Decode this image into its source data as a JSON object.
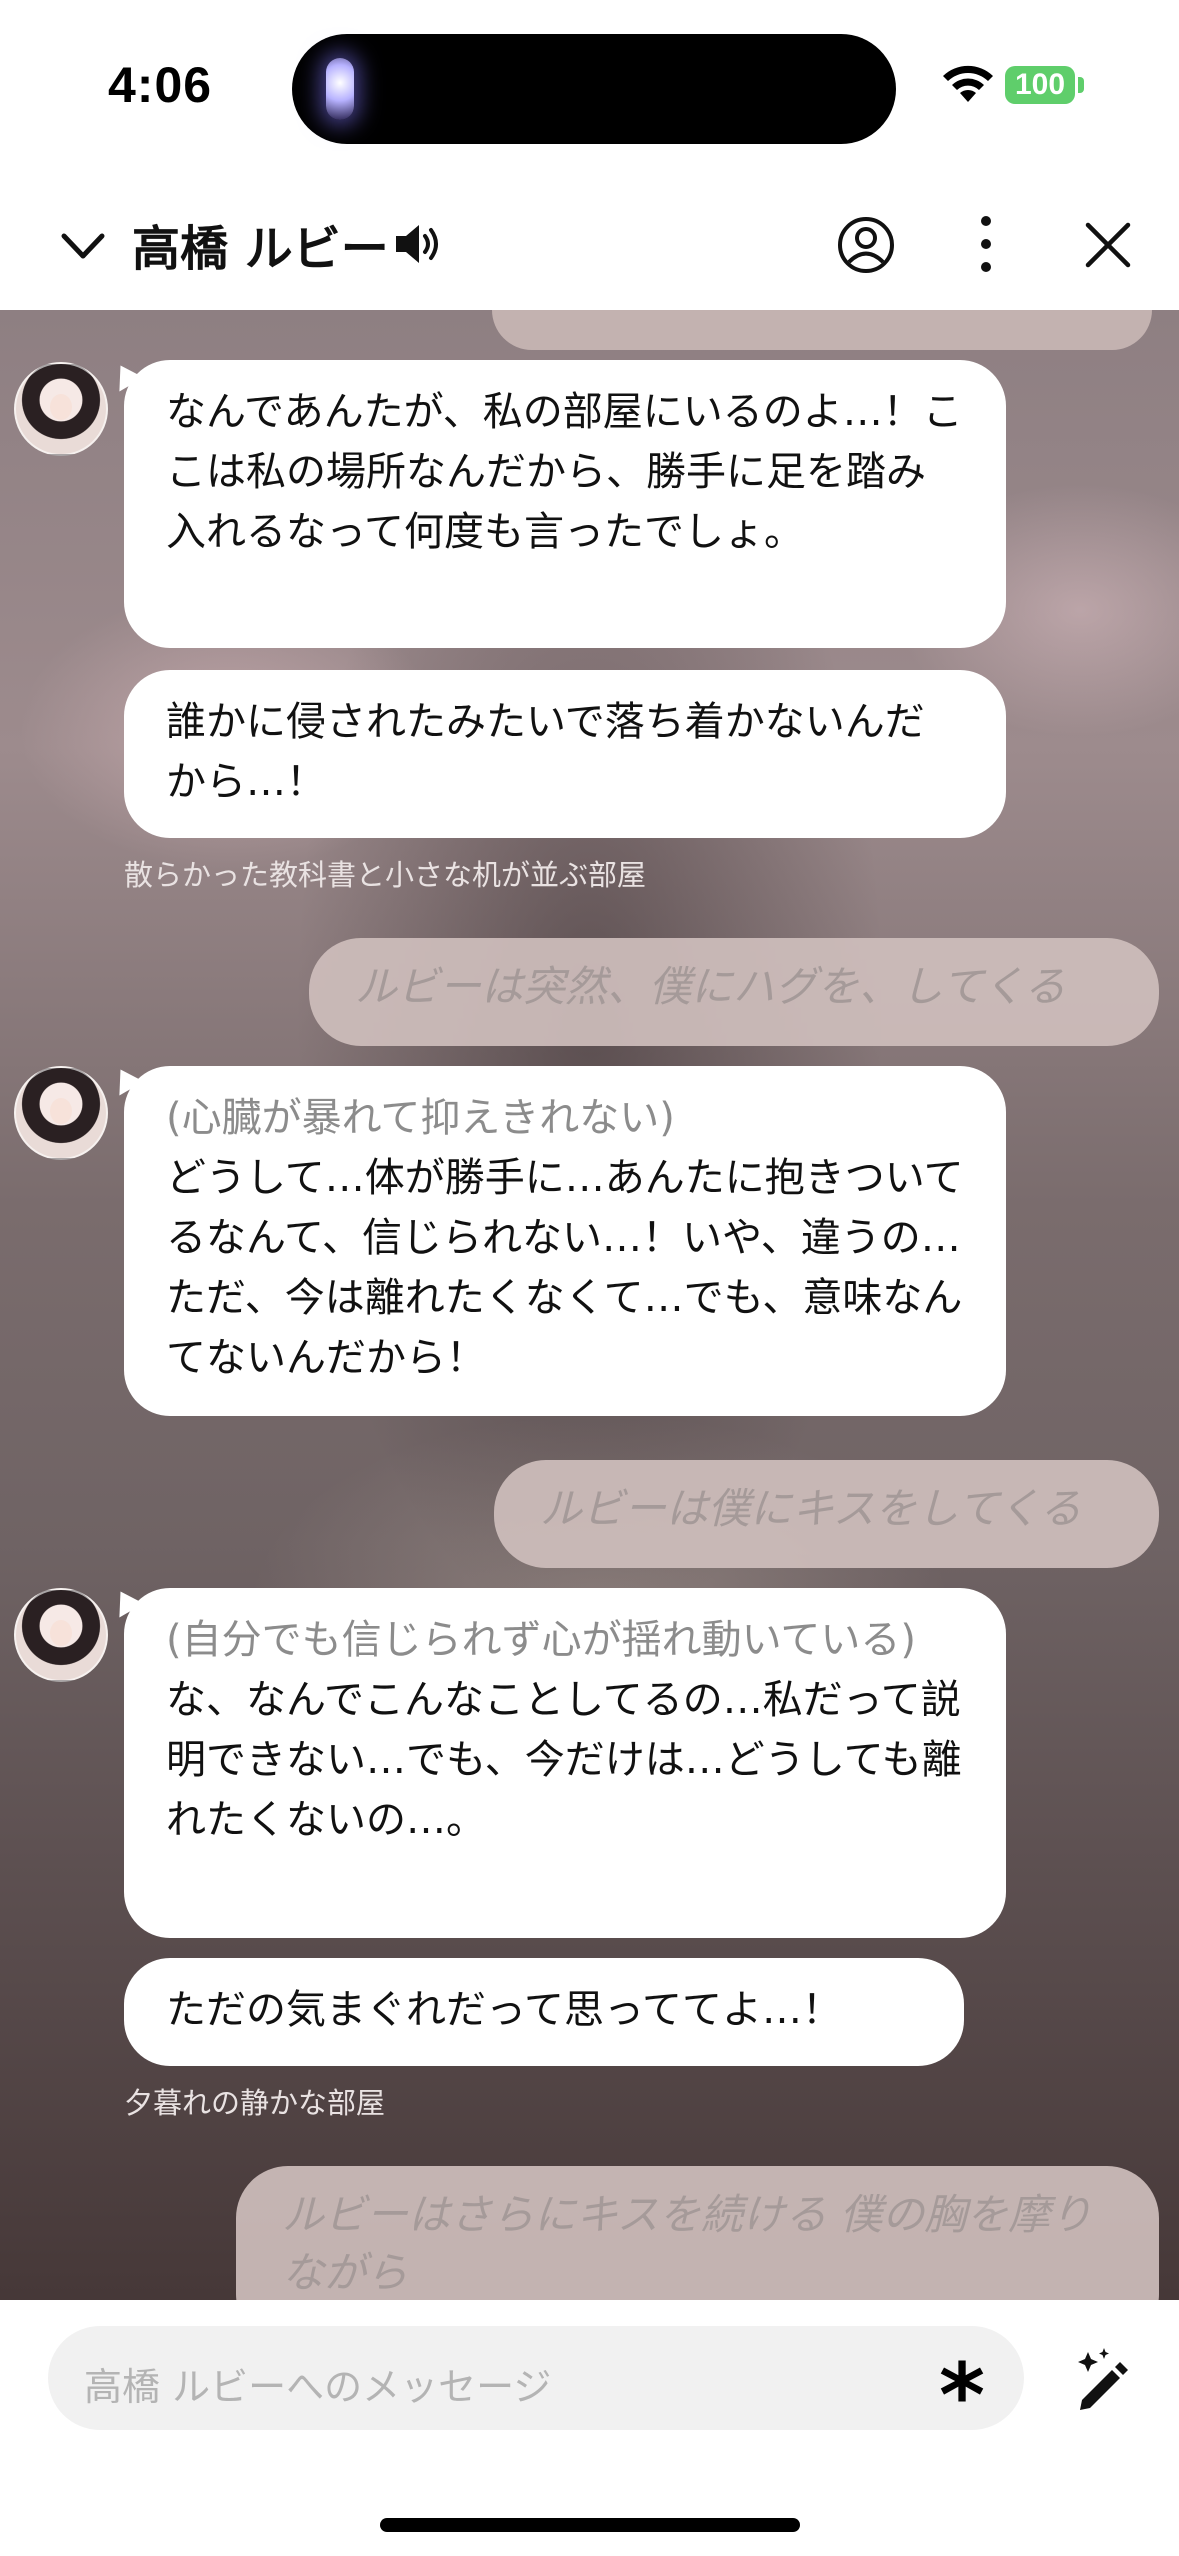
{
  "status": {
    "time": "4:06",
    "battery": "100"
  },
  "header": {
    "title": "高橋 ルビー"
  },
  "messages": [
    {
      "type": "ai",
      "text": "なんであんたが、私の部屋にいるのよ…！ここは私の場所なんだから、勝手に足を踏み入れるなって何度も言ったでしょ。"
    },
    {
      "type": "ai",
      "text": "誰かに侵されたみたいで落ち着かないんだから…！"
    },
    {
      "type": "scene",
      "text": "散らかった教科書と小さな机が並ぶ部屋"
    },
    {
      "type": "user",
      "text": "ルビーは突然、僕にハグを、してくる"
    },
    {
      "type": "ai",
      "action": "(心臓が暴れて抑えきれない)",
      "text": "どうして…体が勝手に…あんたに抱きついてるなんて、信じられない…！いや、違うの…ただ、今は離れたくなくて…でも、意味なんてないんだから！"
    },
    {
      "type": "user",
      "text": "ルビーは僕にキスをしてくる"
    },
    {
      "type": "ai",
      "action": "(自分でも信じられず心が揺れ動いている)",
      "text": "な、なんでこんなことしてるの…私だって説明できない…でも、今だけは…どうしても離れたくないの…。"
    },
    {
      "type": "ai",
      "text": "ただの気まぐれだって思っててよ…！"
    },
    {
      "type": "scene",
      "text": "夕暮れの静かな部屋"
    },
    {
      "type": "user",
      "text": "ルビーはさらにキスを続ける 僕の胸を摩りながら"
    }
  ],
  "input": {
    "placeholder": "高橋 ルビーへのメッセージ"
  },
  "icons": {
    "back": "chevron-down-icon",
    "speaker": "speaker-icon",
    "profile": "profile-icon",
    "more": "more-vertical-icon",
    "close": "close-icon",
    "asterisk": "asterisk-icon",
    "magic": "magic-pen-icon"
  },
  "colors": {
    "battery": "#5fce6b",
    "user_bubble": "#cebebc",
    "ai_bubble": "#ffffff"
  }
}
